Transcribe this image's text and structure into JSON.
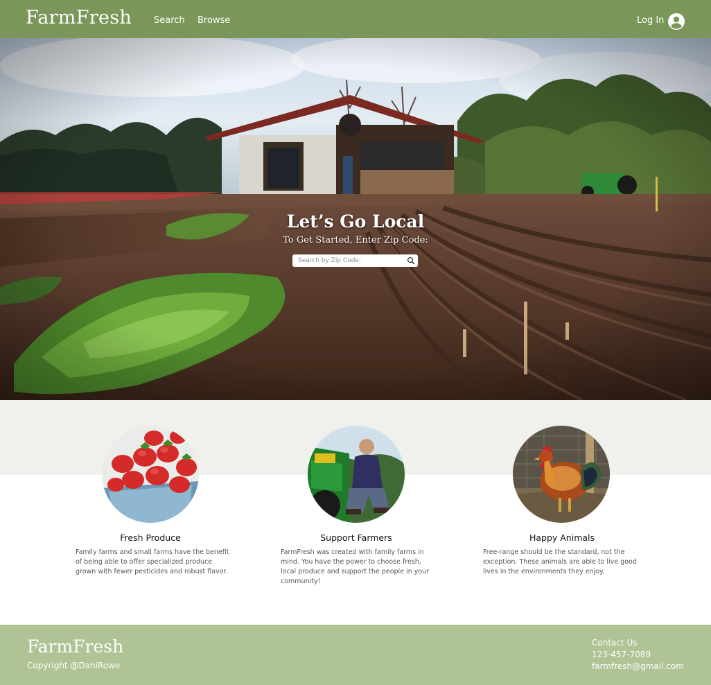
{
  "header": {
    "brand": "FarmFresh",
    "nav": [
      "Search",
      "Browse"
    ],
    "login_label": "Log In"
  },
  "hero": {
    "title": "Let’s Go Local",
    "subtitle": "To Get Started, Enter Zip Code:",
    "zip_placeholder": "Search by Zip Code:"
  },
  "features": [
    {
      "title": "Fresh Produce",
      "text": "Family farms and small farms have the benefit of being able to offer specialized produce grown with fewer pesticides and robust flavor."
    },
    {
      "title": "Support Farmers",
      "text": "FarmFresh was created with family farms in mind. You have the power to choose fresh, local produce and support the people in your community!"
    },
    {
      "title": "Happy Animals",
      "text": "Free-range should be the standard, not the exception. These animals are able to live good lives in the environments they enjoy."
    }
  ],
  "footer": {
    "brand": "FarmFresh",
    "copyright": "Copyright @DaniRowe",
    "contact_heading": "Contact Us",
    "phone": "123-457-7089",
    "email": "farmfresh@gmail.com"
  },
  "colors": {
    "header_bg": "#7a9759",
    "footer_bg": "#afc395",
    "band_bg": "#f0f0ec"
  }
}
